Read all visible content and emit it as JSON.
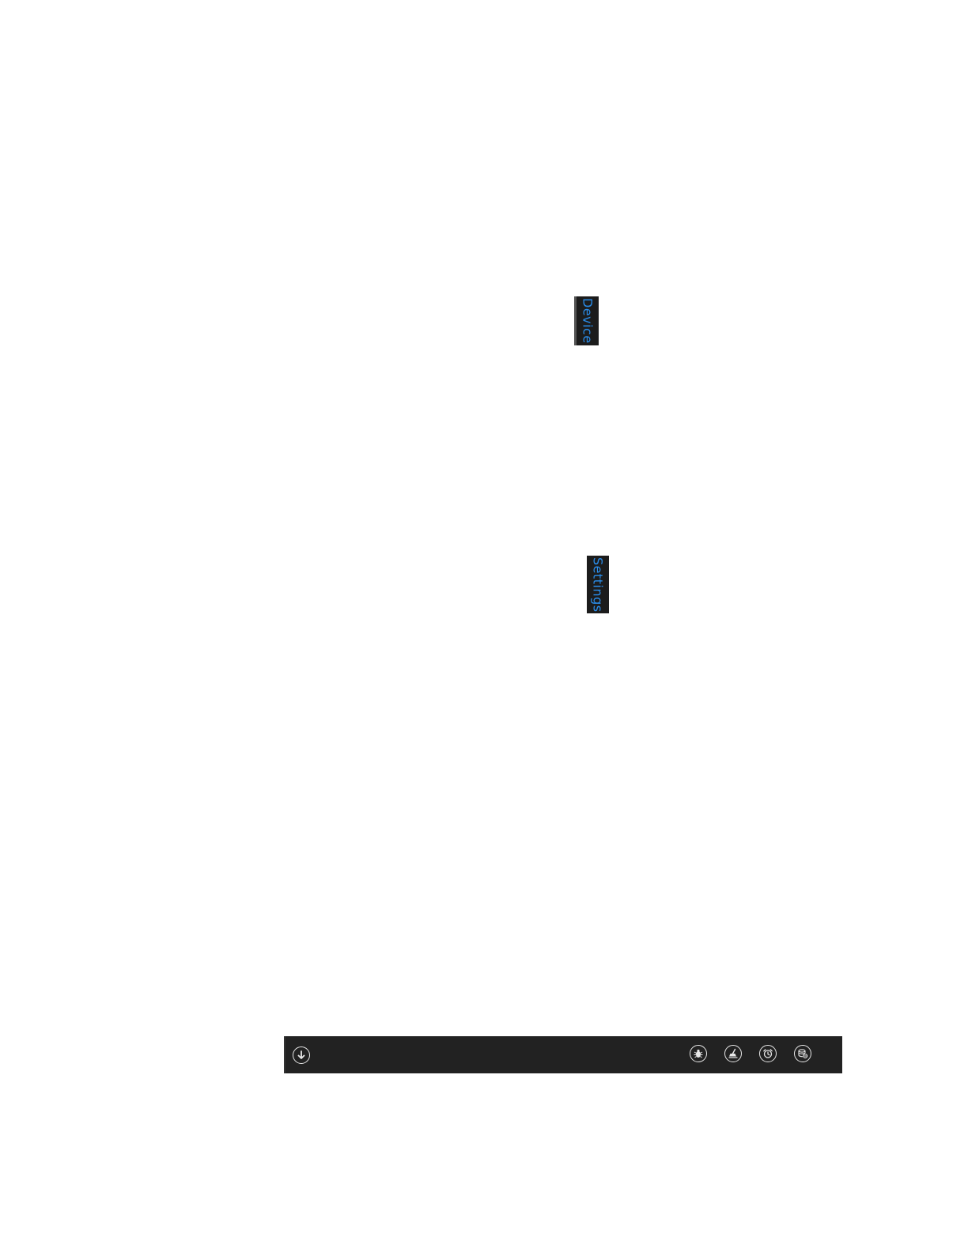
{
  "tabs": {
    "device": {
      "label": "Device"
    },
    "settings": {
      "label": "Settings"
    }
  },
  "app_bar": {
    "left_buttons": [
      {
        "icon": "arrow-down-circle-icon"
      }
    ],
    "right_buttons": [
      {
        "icon": "bug-icon"
      },
      {
        "icon": "broom-icon"
      },
      {
        "icon": "alarm-clock-icon"
      },
      {
        "icon": "database-settings-icon"
      }
    ]
  },
  "colors": {
    "tab_background": "#1c1c1c",
    "tab_text": "#2a8dea",
    "app_bar_background": "#222222",
    "icon_color": "#e8e8e8",
    "page_background": "#ffffff"
  }
}
